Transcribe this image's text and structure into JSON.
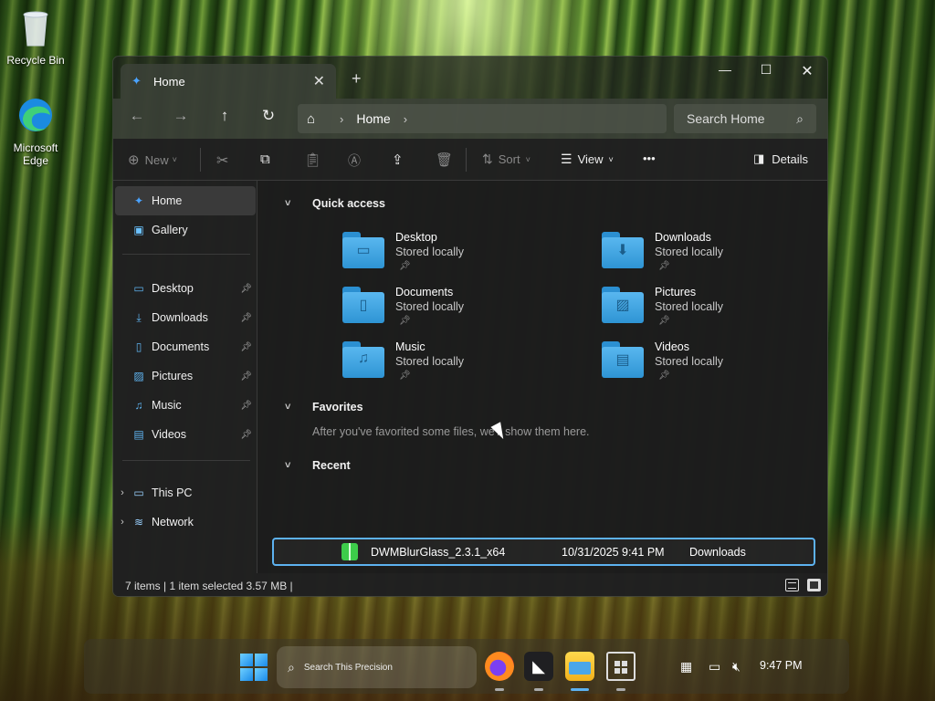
{
  "desktop": {
    "icons": [
      {
        "label": "Recycle Bin",
        "icon": "recycle-bin-icon"
      },
      {
        "label": "Microsoft Edge",
        "icon": "edge-icon"
      }
    ]
  },
  "window": {
    "tab_label": "Home",
    "address": {
      "segments": [
        "Home"
      ]
    },
    "search_placeholder": "Search Home",
    "toolbar": {
      "new_label": "New",
      "sort_label": "Sort",
      "view_label": "View",
      "more_label": "•••",
      "details_label": "Details"
    },
    "sidebar": {
      "items": [
        {
          "label": "Home",
          "icon": "home-icon"
        },
        {
          "label": "Gallery",
          "icon": "gallery-icon"
        },
        {
          "label": "Desktop",
          "icon": "desktop-icon",
          "pinned": true
        },
        {
          "label": "Downloads",
          "icon": "downloads-icon",
          "pinned": true
        },
        {
          "label": "Documents",
          "icon": "documents-icon",
          "pinned": true
        },
        {
          "label": "Pictures",
          "icon": "pictures-icon",
          "pinned": true
        },
        {
          "label": "Music",
          "icon": "music-icon",
          "pinned": true
        },
        {
          "label": "Videos",
          "icon": "videos-icon",
          "pinned": true
        },
        {
          "label": "This PC",
          "icon": "this-pc-icon"
        },
        {
          "label": "Network",
          "icon": "network-icon"
        }
      ]
    },
    "quick_access": {
      "title": "Quick access",
      "items": [
        {
          "name": "Desktop",
          "sub": "Stored locally"
        },
        {
          "name": "Downloads",
          "sub": "Stored locally"
        },
        {
          "name": "Documents",
          "sub": "Stored locally"
        },
        {
          "name": "Pictures",
          "sub": "Stored locally"
        },
        {
          "name": "Music",
          "sub": "Stored locally"
        },
        {
          "name": "Videos",
          "sub": "Stored locally"
        }
      ]
    },
    "favorites": {
      "title": "Favorites",
      "empty_text": "After you've favorited some files, we'll show them here."
    },
    "recent": {
      "title": "Recent",
      "files": [
        {
          "name": "DWMBlurGlass_2.3.1_x64",
          "date": "10/31/2025 9:41 PM",
          "location": "Downloads"
        }
      ]
    },
    "status": "7 items  |  1 item selected  3.57 MB  |"
  },
  "taskbar": {
    "search_placeholder": "Search This Precision",
    "time": "9:47 PM"
  },
  "colors": {
    "accent": "#5db2f0",
    "folder": "#3ea0e0"
  }
}
